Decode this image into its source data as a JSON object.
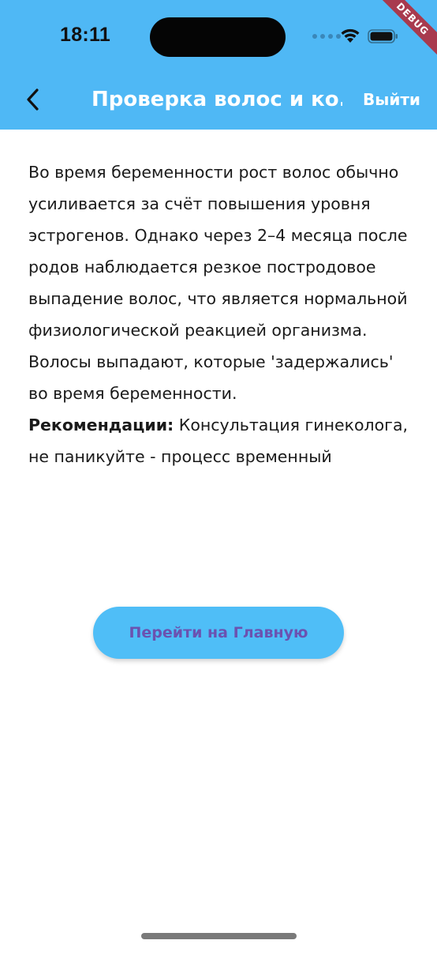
{
  "status_bar": {
    "time": "18:11",
    "icons": [
      "cellular-dots-icon",
      "wifi-icon",
      "battery-icon"
    ]
  },
  "debug_banner": "DEBUG",
  "app_bar": {
    "back_icon": "chevron-left-icon",
    "title": "Проверка волос и ко...",
    "logout_label": "Выйти"
  },
  "content": {
    "paragraph": "Во время беременности рост волос обычно усиливается за счёт повышения уровня эстрогенов. Однако через 2–4 месяца после родов наблюдается резкое постродовое выпадение волос, что является нормальной физиологической реакцией организма. Волосы выпадают, которые 'задержались' во время беременности.",
    "recommendation_label": "Рекомендации:",
    "recommendation_text": " Консультация гинеколога, не паникуйте - процесс временный"
  },
  "home_button": {
    "label": "Перейти на Главную"
  },
  "colors": {
    "header_background": "#4fb8f5",
    "button_background": "#4fbef7",
    "button_text": "#6b52b0",
    "debug_ribbon": "#a83a4e"
  }
}
